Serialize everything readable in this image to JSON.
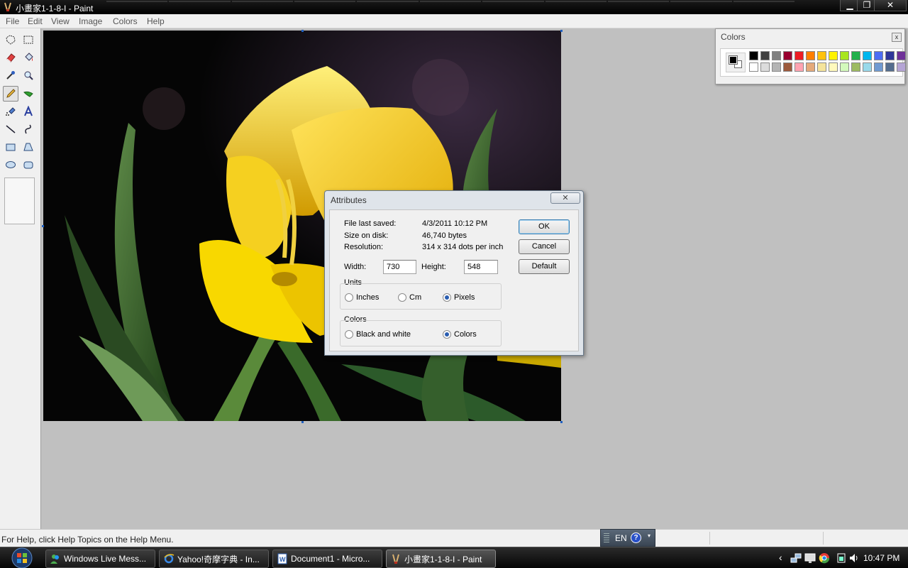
{
  "window": {
    "title": "小畫家1-1-8-I - Paint",
    "minimize_glyph": "▁",
    "maximize_glyph": "❐",
    "close_glyph": "✕"
  },
  "menu": [
    "File",
    "Edit",
    "View",
    "Image",
    "Colors",
    "Help"
  ],
  "toolbox": {
    "tools": [
      "free-form-select",
      "select",
      "eraser",
      "fill-with-color",
      "pick-color",
      "magnifier",
      "pencil",
      "brush",
      "airbrush",
      "text",
      "line",
      "curve",
      "rectangle",
      "polygon",
      "ellipse",
      "rounded-rectangle"
    ],
    "selected_tool": "pencil"
  },
  "colors_window": {
    "title": "Colors",
    "close_glyph": "x",
    "foreground": "#000000",
    "background": "#ffffff",
    "palette": [
      "#000000",
      "#404040",
      "#808080",
      "#990030",
      "#ed1c24",
      "#ff7e00",
      "#ffc20e",
      "#fff200",
      "#a8e61d",
      "#22b14c",
      "#00b7ef",
      "#4d6df3",
      "#2f3699",
      "#6f3198",
      "#ffffff",
      "#dcdcdc",
      "#b4b4b4",
      "#9c5a3c",
      "#ffa3b1",
      "#e5aa7a",
      "#f5e49c",
      "#fff9bd",
      "#d3f9bc",
      "#9dbb61",
      "#99d9ea",
      "#709ad1",
      "#546d8e",
      "#b5a5d5"
    ]
  },
  "dialog": {
    "title": "Attributes",
    "close_glyph": "✕",
    "file_last_saved_label": "File last saved:",
    "file_last_saved_value": "4/3/2011 10:12 PM",
    "size_on_disk_label": "Size on disk:",
    "size_on_disk_value": "46,740 bytes",
    "resolution_label": "Resolution:",
    "resolution_value": "314 x 314 dots per inch",
    "width_label": "Width:",
    "width_value": "730",
    "height_label": "Height:",
    "height_value": "548",
    "units_label": "Units",
    "units_options": [
      "Inches",
      "Cm",
      "Pixels"
    ],
    "units_selected": "Pixels",
    "colors_label": "Colors",
    "colors_options": [
      "Black and white",
      "Colors"
    ],
    "colors_selected": "Colors",
    "ok_label": "OK",
    "cancel_label": "Cancel",
    "default_label": "Default"
  },
  "statusbar": {
    "help_text": "For Help, click Help Topics on the Help Menu.",
    "language": "EN",
    "help_glyph": "?",
    "options_glyph": "▾"
  },
  "taskbar": {
    "buttons": [
      {
        "label": "Windows Live Mess...",
        "icon": "messenger-icon"
      },
      {
        "label": "Yahoo!奇摩字典 - In...",
        "icon": "internet-explorer-icon"
      },
      {
        "label": "Document1 - Micro...",
        "icon": "word-icon"
      },
      {
        "label": "小畫家1-1-8-I - Paint",
        "icon": "paint-icon"
      }
    ],
    "tray_expand_glyph": "‹",
    "clock": "10:47 PM"
  }
}
